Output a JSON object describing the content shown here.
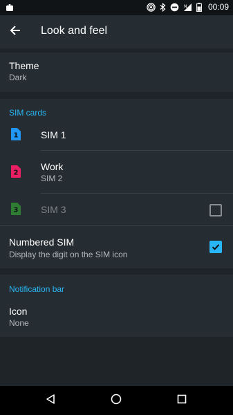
{
  "status_bar": {
    "time": "00:09",
    "icons": [
      "android-icon",
      "hotspot-icon",
      "bluetooth-icon",
      "do-not-disturb-icon",
      "signal-icon",
      "battery-icon"
    ]
  },
  "app_bar": {
    "title": "Look and feel",
    "back_icon": "arrow-back-icon"
  },
  "theme": {
    "title": "Theme",
    "value": "Dark"
  },
  "sim_cards": {
    "header": "SIM cards",
    "items": [
      {
        "digit": "1",
        "title": "SIM 1",
        "subtitle": "",
        "color": "#2196f3",
        "enabled": true
      },
      {
        "digit": "2",
        "title": "Work",
        "subtitle": "SIM 2",
        "color": "#e91e63",
        "enabled": true
      },
      {
        "digit": "3",
        "title": "SIM 3",
        "subtitle": "",
        "color": "#2e7d32",
        "enabled": false,
        "checked": false
      }
    ]
  },
  "numbered_sim": {
    "title": "Numbered SIM",
    "subtitle": "Display the digit on the SIM icon",
    "checked": true
  },
  "notification_bar": {
    "header": "Notification bar",
    "icon_title": "Icon",
    "icon_value": "None"
  },
  "nav_bar": {
    "icons": [
      "back-triangle-icon",
      "home-circle-icon",
      "recents-square-icon"
    ]
  },
  "colors": {
    "accent": "#29b6f6",
    "background": "#1f2428",
    "card": "#262d32"
  }
}
